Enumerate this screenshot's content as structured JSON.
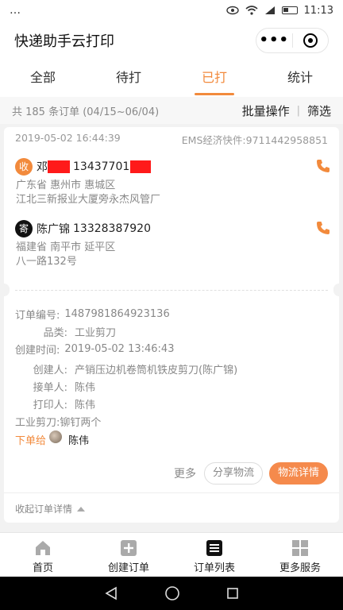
{
  "status_bar": {
    "time": "11:13"
  },
  "header": {
    "title": "快递助手云打印"
  },
  "tabs": [
    {
      "label": "全部"
    },
    {
      "label": "待打"
    },
    {
      "label": "已打"
    },
    {
      "label": "统计"
    }
  ],
  "summary": {
    "count_text": "共 185 条订单 (04/15~06/04)",
    "batch_label": "批量操作",
    "filter_label": "筛选"
  },
  "order": {
    "datetime": "2019-05-02 16:44:39",
    "express": "EMS经济快件:9711442958851",
    "receiver": {
      "badge": "收",
      "name": "邓",
      "phone": "13437701",
      "region": "广东省 惠州市 惠城区",
      "street": "江北三新报业大厦旁永杰风管厂"
    },
    "sender": {
      "badge": "寄",
      "name": "陈广锦",
      "phone": "13328387920",
      "region": "福建省 南平市 延平区",
      "street": "八一路132号"
    },
    "details": {
      "order_no_label": "订单编号:",
      "order_no": "1487981864923136",
      "category_label": "品类:",
      "category": "工业剪刀",
      "created_label": "创建时间:",
      "created": "2019-05-02 13:46:43",
      "creator_label": "创建人:",
      "creator": "产销压边机卷筒机铁皮剪刀(陈广锦)",
      "receiver_label": "接单人:",
      "receiver": "陈伟",
      "printer_label": "打印人:",
      "printer": "陈伟",
      "note": "工业剪刀:铆钉两个",
      "assign_label": "下单给",
      "assign_name": "陈伟"
    },
    "more_label": "更多",
    "share_label": "分享物流",
    "logistics_label": "物流详情",
    "collapse_label": "收起订单详情"
  },
  "bottom_nav": [
    {
      "label": "首页",
      "icon": "home-icon"
    },
    {
      "label": "创建订单",
      "icon": "plus-icon"
    },
    {
      "label": "订单列表",
      "icon": "list-icon"
    },
    {
      "label": "更多服务",
      "icon": "grid-icon"
    }
  ],
  "colors": {
    "accent": "#f28a3c",
    "redaction": "#ff1a1a"
  }
}
